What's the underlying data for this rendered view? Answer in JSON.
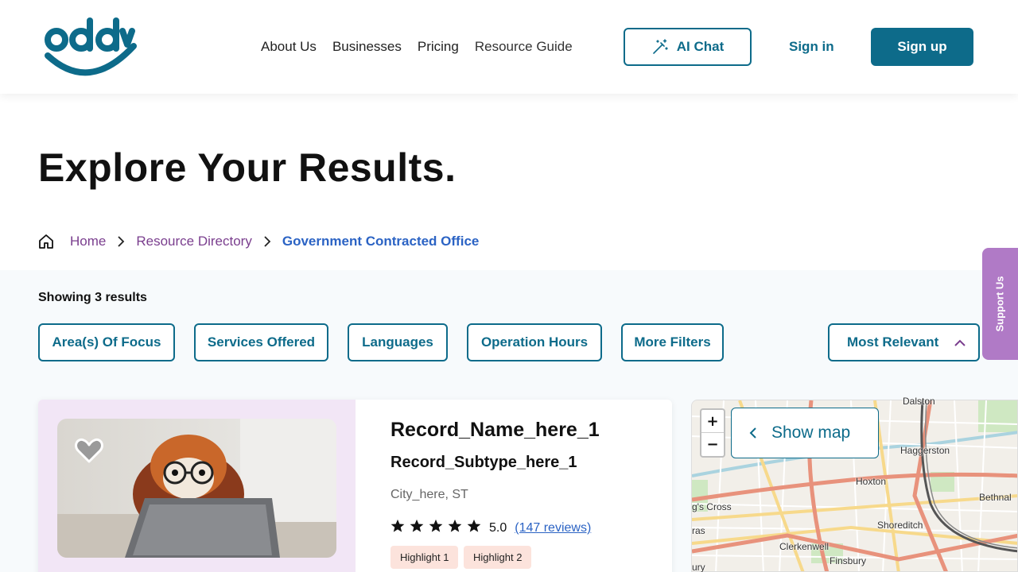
{
  "header": {
    "logo_text": "oddy",
    "nav": [
      "About Us",
      "Businesses",
      "Pricing",
      "Resource Guide"
    ],
    "ai_chat_label": "AI Chat",
    "signin_label": "Sign in",
    "signup_label": "Sign up"
  },
  "page": {
    "title": "Explore Your Results.",
    "breadcrumb": [
      "Home",
      "Resource Directory",
      "Government Contracted Office"
    ]
  },
  "results": {
    "showing": "Showing 3 results",
    "filters": [
      "Area(s) Of Focus",
      "Services Offered",
      "Languages",
      "Operation Hours",
      "More Filters"
    ],
    "sort_label": "Most Relevant"
  },
  "support_label": "Support Us",
  "card": {
    "name": "Record_Name_here_1",
    "subtype": "Record_Subtype_here_1",
    "city": "City_here, ST",
    "rating": "5.0",
    "reviews": "(147 reviews)",
    "highlights": [
      "Highlight 1",
      "Highlight 2"
    ]
  },
  "map": {
    "zoom_in": "+",
    "zoom_out": "−",
    "show_map_label": "Show map",
    "labels": [
      "Dalston",
      "Haggerston",
      "Hoxton",
      "Bethnal",
      "g's Cross",
      "Shoreditch",
      "ras",
      "Clerkenwell",
      "Finsbury",
      "ury"
    ]
  },
  "colors": {
    "brand": "#0d6b8a",
    "breadcrumb_link": "#7a3e8e",
    "breadcrumb_current": "#2b63c4",
    "support_tab": "#b07ac6",
    "card_left_bg": "#f2e6f6",
    "chip_bg": "#fce3dc"
  }
}
